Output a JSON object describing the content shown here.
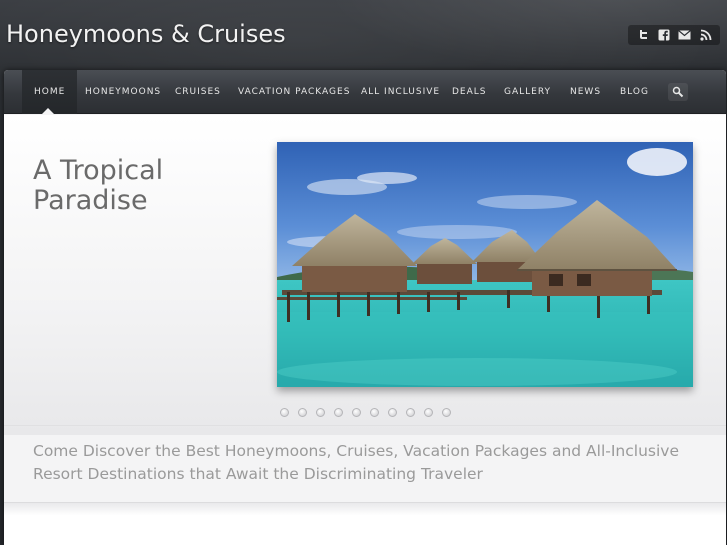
{
  "site": {
    "title": "Honeymoons & Cruises"
  },
  "social": {
    "icons": [
      "twitter-icon",
      "facebook-icon",
      "email-icon",
      "rss-icon"
    ]
  },
  "nav": {
    "items": [
      {
        "label": "HOME",
        "active": true
      },
      {
        "label": "HONEYMOONS"
      },
      {
        "label": "CRUISES"
      },
      {
        "label": "VACATION PACKAGES"
      },
      {
        "label": "ALL INCLUSIVE"
      },
      {
        "label": "DEALS"
      },
      {
        "label": "GALLERY"
      },
      {
        "label": "NEWS"
      },
      {
        "label": "BLOG"
      }
    ],
    "search_icon": "search-icon"
  },
  "hero": {
    "heading_line1": "A Tropical",
    "heading_line2": "Paradise",
    "slide_count": 10,
    "active_slide": 1
  },
  "tagline": {
    "line1": "Come Discover the Best Honeymoons, Cruises, Vacation Packages and All-Inclusive",
    "line2": "Resort Destinations that Await the Discriminating Traveler"
  },
  "colors": {
    "background": "#2b2e33",
    "nav": "#35383d",
    "panel": "#f4f4f5",
    "heading": "#6a6a6a",
    "tagline": "#9a9a9a",
    "water": "#3fc1c0"
  }
}
